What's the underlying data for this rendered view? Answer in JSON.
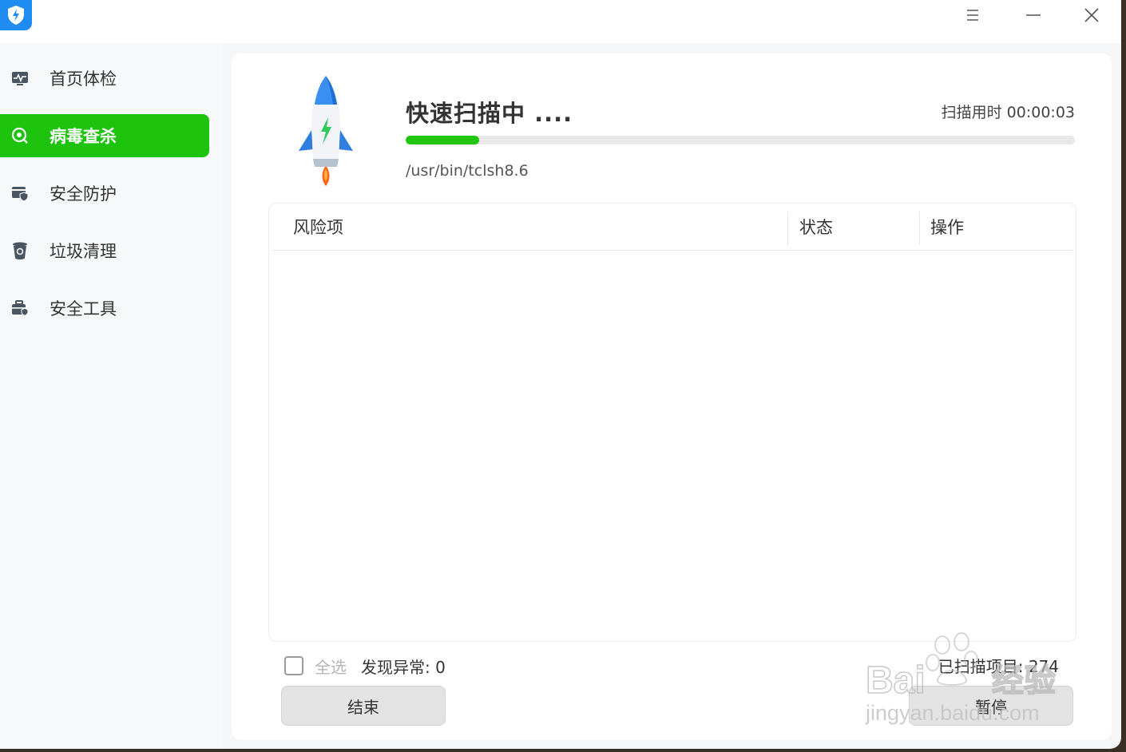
{
  "window": {
    "controls": {
      "menu": "menu-icon",
      "minimize": "minimize-icon",
      "close": "close-icon"
    }
  },
  "sidebar": {
    "items": [
      {
        "label": "首页体检",
        "icon": "monitor-pulse-icon",
        "active": false
      },
      {
        "label": "病毒查杀",
        "icon": "virus-scan-icon",
        "active": true
      },
      {
        "label": "安全防护",
        "icon": "shield-card-icon",
        "active": false
      },
      {
        "label": "垃圾清理",
        "icon": "trash-bin-icon",
        "active": false
      },
      {
        "label": "安全工具",
        "icon": "toolbox-icon",
        "active": false
      }
    ]
  },
  "scan": {
    "title": "快速扫描中 ....",
    "time_label": "扫描用时 00:00:03",
    "progress_percent": 11,
    "current_path": "/usr/bin/tclsh8.6"
  },
  "table": {
    "columns": [
      "风险项",
      "状态",
      "操作"
    ],
    "rows": []
  },
  "footer": {
    "select_all": "全选",
    "found_label": "发现异常: 0",
    "scanned_label": "已扫描项目: 274",
    "end_button": "结束",
    "pause_button": "暂停"
  },
  "watermark": {
    "brand": "Bai",
    "brand_cn": "经验",
    "url": "jingyan.baidu.com"
  },
  "colors": {
    "accent_green": "#1ec30e",
    "brand_blue": "#1e8cf0"
  }
}
